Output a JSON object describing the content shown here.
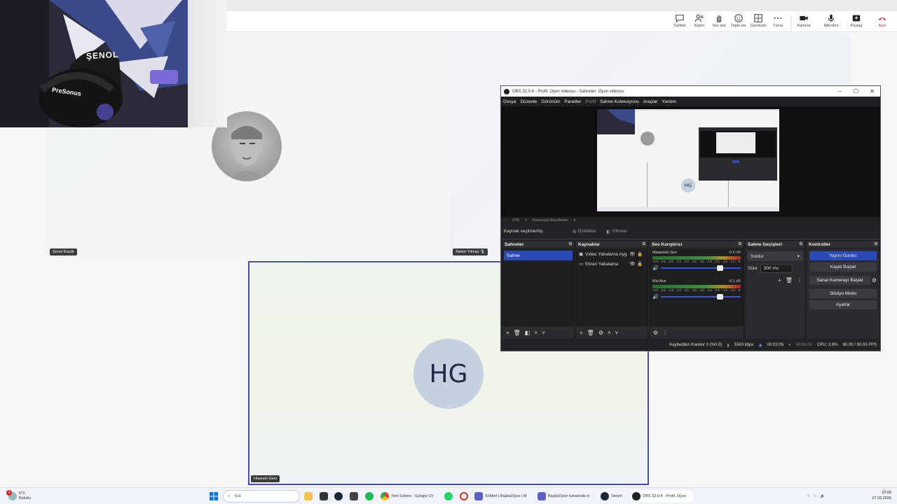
{
  "teams": {
    "toolbar": [
      {
        "label": "Sohbet",
        "icon": "chat-icon"
      },
      {
        "label": "Kişiler",
        "icon": "people-icon"
      },
      {
        "label": "Söz iste",
        "icon": "raise-hand-icon"
      },
      {
        "label": "Tepki ver",
        "icon": "react-icon"
      },
      {
        "label": "Görünüm",
        "icon": "view-icon"
      },
      {
        "label": "Tümü",
        "icon": "more-icon"
      },
      {
        "label": "Kamera",
        "icon": "camera-icon"
      },
      {
        "label": "Mikrofon",
        "icon": "mic-icon"
      },
      {
        "label": "Paylaş",
        "icon": "share-icon"
      },
      {
        "label": "Ayrıl",
        "icon": "leave-icon"
      }
    ],
    "participants": {
      "p1": "Şenol Küçük",
      "p2": "Tamer Yılmaz",
      "p3": "Hüseyin Gerz",
      "p3_initials": "HG"
    },
    "webcam_cap_text": "ŞENOL",
    "headset_text": "PreSonus"
  },
  "obs": {
    "title": "OBS 32.0.4 - Profil: Oyun videosu - Sahneler: Oyun videosu",
    "menu": [
      "Dosya",
      "Düzenle",
      "Görünüm",
      "Paneller",
      "Profil",
      "Sahne Koleksiyonu",
      "Araçlar",
      "Yardım"
    ],
    "zoom_bar": {
      "minus": "−",
      "zoom": "27%",
      "plus": "+",
      "fit": "Pencereye Boyutlandır"
    },
    "preview_initials": "HG",
    "source_bar": {
      "status": "Kaynak seçilmemiş",
      "properties": "Özellikler",
      "filters": "Filtreler"
    },
    "docks": {
      "scenes": {
        "title": "Sahneler",
        "items": [
          "Sahne"
        ]
      },
      "sources": {
        "title": "Kaynaklar",
        "items": [
          "Video Yakalama Aygıtı",
          "Ekran Yakalama"
        ]
      },
      "mixer": {
        "title": "Ses Karıştırıcı",
        "channels": [
          {
            "name": "Masaüstü Ses",
            "db": "-8.6 dB"
          },
          {
            "name": "Mic/Aux",
            "db": "-8.5 dB"
          }
        ],
        "ticks": "-60 -55 -50 -45 -40 -35 -30 -25 -20 -15 -10 -5 0"
      },
      "transitions": {
        "title": "Sahne Geçişleri",
        "type": "Soldur",
        "duration_label": "Süre",
        "duration": "300 ms"
      },
      "controls": {
        "title": "Kontroller",
        "buttons": [
          "Yayını Durdur",
          "Kaydı Başlat",
          "Sanal Kamerayı Başlat",
          "Stüdyo Modu",
          "Ayarlar"
        ]
      }
    },
    "status": {
      "dropped": "Kaybedilen Kareler 0 (%0.0)",
      "bitrate": "5343 kbps",
      "stream_time": "00:02:09",
      "rec_time": "00:00:00",
      "cpu": "CPU: 2.6%",
      "fps": "60.00 / 60.00 FPS"
    }
  },
  "taskbar": {
    "weather": {
      "temp": "5°C",
      "cond": "Bulutlu",
      "badge": "3"
    },
    "search_placeholder": "Ara",
    "apps": [
      {
        "label": "Yeni Sekme - Google Ch",
        "color": "#e0a020"
      },
      {
        "label": "Sohbet | BaşkaOyun | M",
        "color": "#5b5fc7"
      },
      {
        "label": "BaşkaOyun kanalında tc",
        "color": "#5b5fc7"
      },
      {
        "label": "Steam",
        "color": "#1b2838"
      },
      {
        "label": "OBS 32.0.4 - Profil: Oyun",
        "color": "#222222"
      }
    ],
    "clock": {
      "time": "22:09",
      "date": "27.02.2026"
    }
  }
}
